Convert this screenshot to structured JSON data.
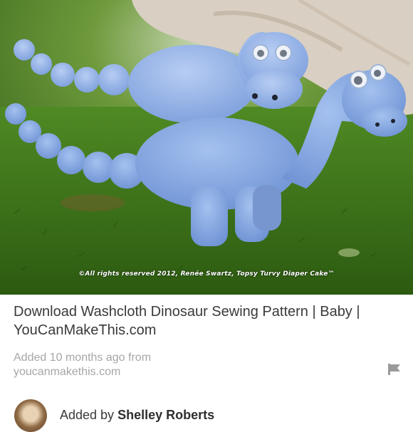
{
  "pin": {
    "image": {
      "subject": "Two blue washcloth dinosaur toys on green moss",
      "watermark": "©All rights reserved 2012, Renée Swartz, Topsy Turvy Diaper Cake™"
    },
    "title": "Download Washcloth Dinosaur Sewing Pattern | Baby | YouCanMakeThis.com",
    "added_prefix": "Added",
    "added_time": "10 months ago",
    "added_from": "from",
    "source_domain": "youcanmakethis.com",
    "flag_icon": "flag-icon"
  },
  "added_by": {
    "prefix": "Added by",
    "name": "Shelley Roberts"
  },
  "colors": {
    "title": "#3a3a3a",
    "meta": "#a6a6a6",
    "moss": "#3f7a1c",
    "dino": "#8aaee6"
  }
}
